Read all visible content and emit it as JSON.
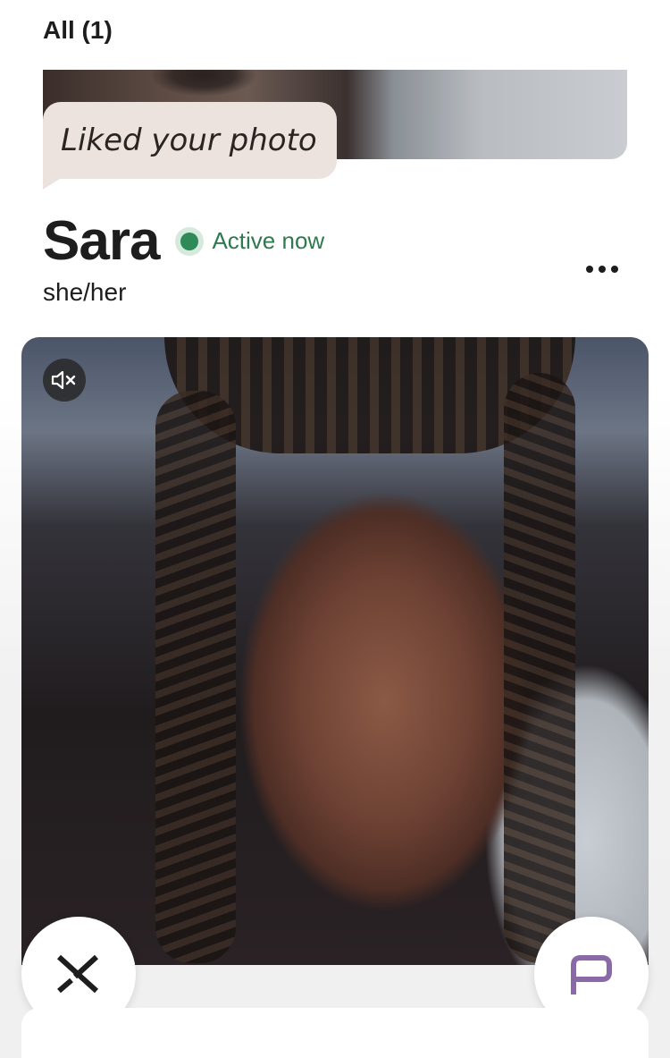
{
  "filter": {
    "label": "All (1)"
  },
  "previous_card": {
    "like_message": "Liked your photo"
  },
  "profile": {
    "name": "Sara",
    "status": "Active now",
    "pronouns": "she/her"
  },
  "media": {
    "type": "video",
    "muted": true,
    "mute_icon": "speaker-muted-icon"
  },
  "actions": {
    "skip_icon": "x-skip-icon",
    "comment_icon": "comment-bubble-icon",
    "more_icon": "more-dots-icon"
  },
  "colors": {
    "status_green": "#2e8a57",
    "bubble_bg": "#ece3de",
    "comment_accent": "#8a6aa6"
  }
}
